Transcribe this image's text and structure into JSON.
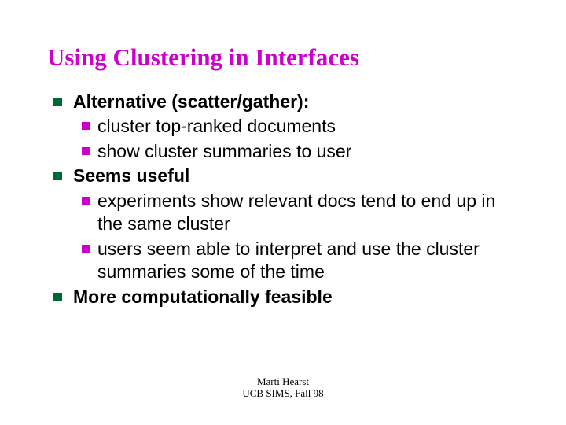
{
  "title": "Using Clustering in Interfaces",
  "items": [
    {
      "text": "Alternative (scatter/gather):",
      "bold": true,
      "subs": [
        "cluster top-ranked documents",
        "show cluster summaries to user"
      ]
    },
    {
      "text": "Seems useful",
      "bold": true,
      "subs": [
        "experiments show relevant docs tend to end up in the same cluster",
        "users seem able to interpret and use the cluster summaries some of the time"
      ]
    },
    {
      "text": "More computationally feasible",
      "bold": true,
      "subs": []
    }
  ],
  "footer": {
    "line1": "Marti Hearst",
    "line2": "UCB SIMS, Fall 98"
  }
}
